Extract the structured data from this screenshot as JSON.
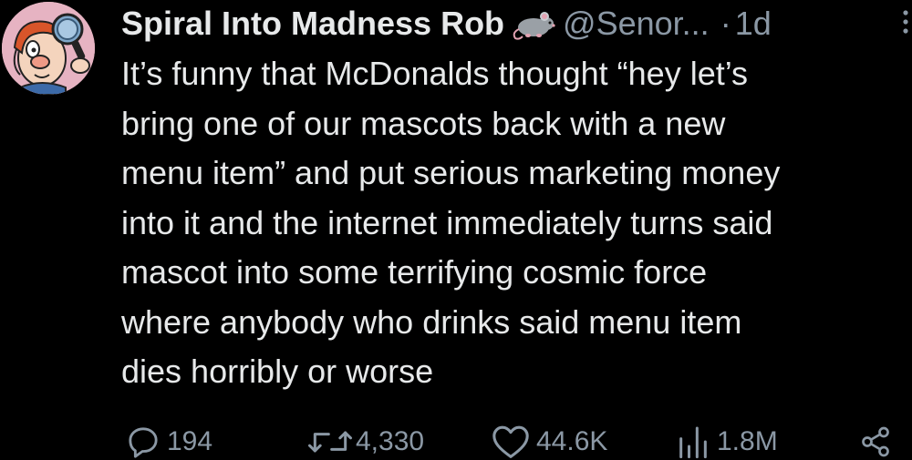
{
  "post": {
    "author": {
      "display_name": "Spiral Into Madness Rob",
      "name_emoji": "rat-emoji",
      "handle": "@Senor...",
      "separator": "·",
      "time": "1d",
      "avatar": "cartoon-avatar-with-magnifying-glass"
    },
    "text": "It’s funny that McDonalds thought “hey let’s\nbring one of our mascots back with a new\nmenu item” and put serious marketing money\ninto it and the internet immediately turns said\nmascot into some terrifying cosmic force\nwhere anybody who drinks said menu item\ndies horribly or worse",
    "actions": {
      "replies": "194",
      "reposts": "4,330",
      "likes": "44.6K",
      "views": "1.8M"
    }
  },
  "icons": {
    "more": "more-vertical-icon",
    "reply": "reply-icon",
    "repost": "repost-icon",
    "like": "heart-icon",
    "views": "views-icon",
    "share": "share-icon"
  },
  "colors": {
    "background": "#000000",
    "primary_text": "#e7e9ea",
    "secondary_text": "#8b98a5"
  }
}
